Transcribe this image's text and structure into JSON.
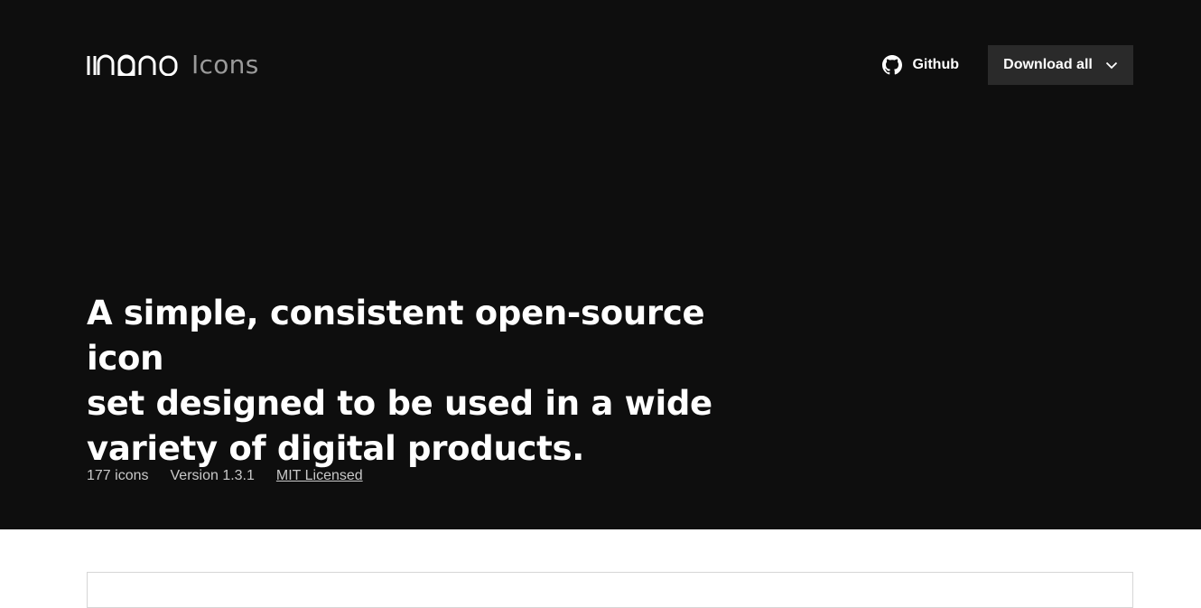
{
  "header": {
    "brand_word": "Icons",
    "github_label": "Github",
    "download_label": "Download all"
  },
  "hero": {
    "headline_line1": "A simple, consistent open-source icon",
    "headline_line2": "set designed to be used in a wide",
    "headline_line3": "variety of digital products.",
    "icon_count": "177 icons",
    "version": "Version 1.3.1",
    "license": "MIT Licensed"
  },
  "icons": {
    "logo": "mono-logo-mark",
    "github": "github-icon",
    "download_chevron": "chevron-down-icon"
  },
  "colors": {
    "hero_bg": "#0e0e0e",
    "button_bg": "#2a2a2a",
    "brand_word": "#9a9a9a",
    "meta_text": "#c9c9c9"
  }
}
